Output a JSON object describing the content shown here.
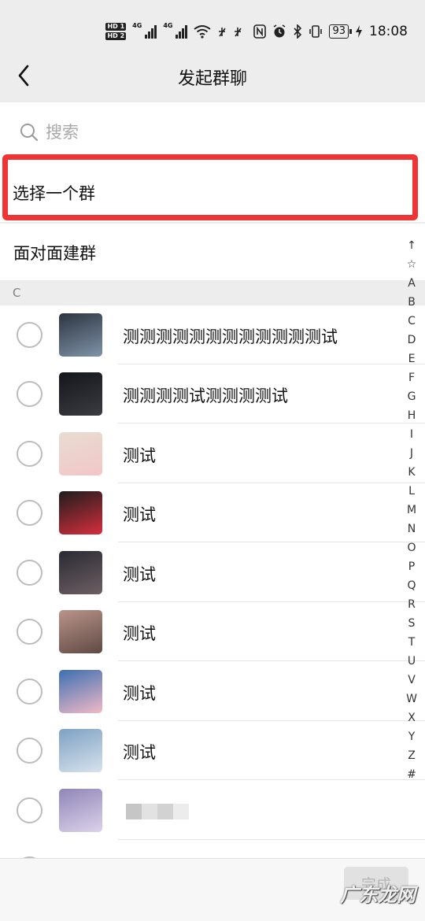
{
  "status_bar": {
    "hd1": "HD 1",
    "hd2": "HD 2",
    "net1": "4G",
    "net2": "4G",
    "battery": "93",
    "time": "18:08"
  },
  "nav": {
    "title": "发起群聊",
    "back_icon": "chevron-left-icon"
  },
  "search": {
    "placeholder": "搜索"
  },
  "options": {
    "select_group": "选择一个群",
    "face_to_face": "面对面建群"
  },
  "section": {
    "letter": "C"
  },
  "contacts": [
    {
      "name": "测测测测测测测测测测测测试",
      "avatar_colors": [
        "#2c3440",
        "#7f93a8"
      ]
    },
    {
      "name": "测测测测试测测测测试",
      "avatar_colors": [
        "#15161b",
        "#3a3c42"
      ]
    },
    {
      "name": "测试",
      "avatar_colors": [
        "#e8ddd2",
        "#f2c6c6"
      ]
    },
    {
      "name": "测试",
      "avatar_colors": [
        "#1d1d1d",
        "#d62e3c"
      ]
    },
    {
      "name": "测试",
      "avatar_colors": [
        "#2a2a33",
        "#6d5f63"
      ]
    },
    {
      "name": "测试",
      "avatar_colors": [
        "#b9948a",
        "#5f4a44"
      ]
    },
    {
      "name": "测试",
      "avatar_colors": [
        "#3d6fb2",
        "#f0b9c7"
      ]
    },
    {
      "name": "测试",
      "avatar_colors": [
        "#7ea1c4",
        "#d7e2ec"
      ]
    },
    {
      "name": "",
      "avatar_colors": [
        "#8f86b8",
        "#dcd2ea"
      ]
    }
  ],
  "index_letters": [
    "↑",
    "☆",
    "A",
    "B",
    "C",
    "D",
    "E",
    "F",
    "G",
    "H",
    "I",
    "J",
    "K",
    "L",
    "M",
    "N",
    "O",
    "P",
    "Q",
    "R",
    "S",
    "T",
    "U",
    "V",
    "W",
    "X",
    "Y",
    "Z",
    "#"
  ],
  "bottom": {
    "done_label": "完成"
  },
  "watermark": "广东龙网",
  "colors": {
    "highlight": "#ee3434",
    "background": "#ededed"
  }
}
